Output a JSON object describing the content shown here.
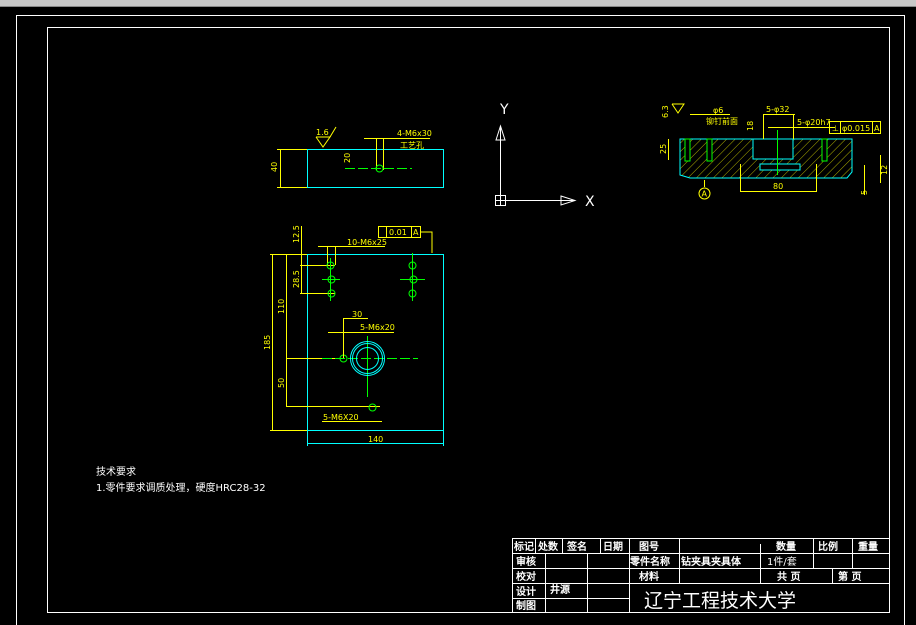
{
  "colors": {
    "background": "#000000",
    "frame": "#ffffff",
    "part": "#00ffff",
    "dimension": "#ffff00",
    "centerline": "#00ff00"
  },
  "side_view": {
    "surface_finish": "1.6",
    "hole_note": "4-M6x30",
    "hole_note2": "工艺孔",
    "dim_height": "40",
    "dim_hole": "20"
  },
  "plan_view": {
    "dim_total": "185",
    "dim_110": "110",
    "dim_50": "50",
    "dim_12_5": "12.5",
    "dim_28_5": "28.5",
    "holes_top": "10-M6x25",
    "tol_value": "0.01",
    "tol_datum": "A",
    "dim_30": "30",
    "holes_mid": "5-M6x20",
    "holes_bottom": "5-M6X20",
    "dim_width": "140"
  },
  "axes": {
    "y_label": "Y",
    "x_label": "X"
  },
  "section_view": {
    "surface_finish": "6.3",
    "hole_dia": "φ6",
    "hole_note": "铆钉前面",
    "bore": "5-φ32",
    "dim_18": "18",
    "pin": "5-φ20h7",
    "tol_symbol": "⊥",
    "tol_value": "φ0.015",
    "tol_datum": "A",
    "dim_25": "25",
    "dim_80": "80",
    "dim_12": "12",
    "dim_5": "5",
    "datum": "A"
  },
  "notes": {
    "title": "技术要求",
    "item1": "1.零件要求调质处理，硬度HRC28-32"
  },
  "title_block": {
    "h_mark": "标记",
    "h_count": "处数",
    "h_sign": "签名",
    "h_date": "日期",
    "review": "审核",
    "check": "校对",
    "design": "设计",
    "designer": "井源",
    "draw": "制图",
    "drawing_no": "图号",
    "part_name_label": "零件名称",
    "part_name": "钻夹具夹具体",
    "material": "材料",
    "qty": "数量",
    "scale": "比例",
    "weight": "重量",
    "qty_value": "1件/套",
    "total_pages": "共  页",
    "page": "第  页",
    "school": "辽宁工程技术大学"
  }
}
